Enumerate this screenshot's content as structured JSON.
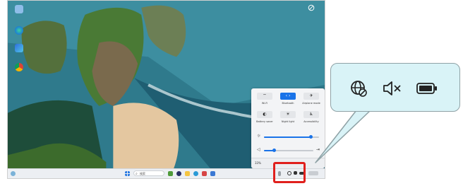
{
  "desktop": {
    "icons": [
      "recycle-bin",
      "microsoft-edge",
      "ms-store",
      "google-chrome"
    ],
    "corner_icon": "no-sign-icon"
  },
  "quick_settings": {
    "tiles": [
      {
        "name": "wifi",
        "label": "Wi-Fi",
        "active": false,
        "glyph": "⌔"
      },
      {
        "name": "bluetooth",
        "label": "Bluetooth",
        "active": true,
        "glyph": "‹›"
      },
      {
        "name": "airplane",
        "label": "Airplane mode",
        "active": false,
        "glyph": "✈"
      },
      {
        "name": "battery-saver",
        "label": "Battery saver",
        "active": false,
        "glyph": "◐"
      },
      {
        "name": "night-light",
        "label": "Night light",
        "active": false,
        "glyph": "☀"
      },
      {
        "name": "accessibility",
        "label": "Accessibility",
        "active": false,
        "glyph": "♿"
      }
    ],
    "brightness_level": 0.85,
    "volume_level": 0.2,
    "battery": "33%"
  },
  "taskbar": {
    "search_placeholder": "検索",
    "pinned_apps": [
      "weather",
      "copilot",
      "file-explorer",
      "edge",
      "store",
      "mail"
    ],
    "tray_icons": [
      "globe-no-network-icon",
      "speaker-muted-icon",
      "battery-icon"
    ]
  },
  "callout": {
    "icons": [
      "globe-no-network-icon",
      "speaker-muted-icon",
      "battery-icon"
    ],
    "highlight_color": "#e0201d",
    "bubble_color": "#d9f3f7"
  }
}
